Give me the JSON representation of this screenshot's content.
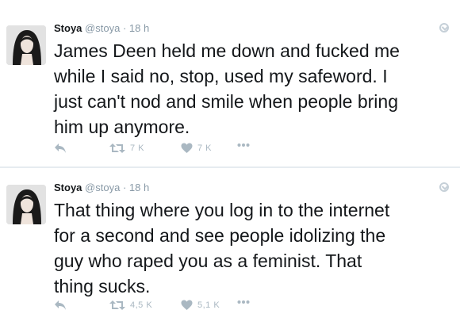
{
  "tweets": [
    {
      "name": "Stoya",
      "handle": "@stoya",
      "dot": "·",
      "time": "18 h",
      "text": "James Deen held me down and fucked me\nwhile I said no, stop, used my safeword. I\njust can't nod and smile when people bring\nhim up anymore.",
      "retweets": "7 K",
      "likes": "7 K"
    },
    {
      "name": "Stoya",
      "handle": "@stoya",
      "dot": "·",
      "time": "18 h",
      "text": "That thing where you log in to the internet\nfor a second and see people idolizing the\nguy who raped you as a feminist. That\nthing sucks.",
      "retweets": "4,5 K",
      "likes": "5,1 K"
    }
  ],
  "icons": {
    "reply": "reply-icon",
    "retweet": "retweet-icon",
    "like": "heart-icon",
    "more": "more-icon",
    "caret": "chevron-down-icon"
  },
  "colors": {
    "name": "#14171a",
    "meta": "#8899a6",
    "action": "#aab8c2",
    "divider": "#e6ecf0"
  }
}
